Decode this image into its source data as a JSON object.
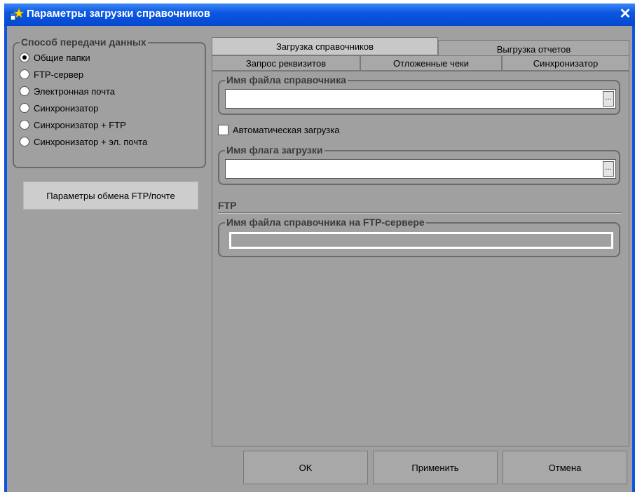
{
  "window": {
    "title": "Параметры загрузки справочников",
    "icon": "app-settings-icon",
    "close_icon": "close-icon"
  },
  "transfer": {
    "legend": "Способ передачи данных",
    "options": [
      {
        "label": "Общие папки",
        "checked": true
      },
      {
        "label": "FTP-сервер",
        "checked": false
      },
      {
        "label": "Электронная почта",
        "checked": false
      },
      {
        "label": "Синхронизатор",
        "checked": false
      },
      {
        "label": "Синхронизатор + FTP",
        "checked": false
      },
      {
        "label": "Синхронизатор + эл. почта",
        "checked": false
      }
    ]
  },
  "ftp_params_button": "Параметры обмена FTP/почте",
  "tabs": {
    "row_top": [
      {
        "label": "Загрузка справочников",
        "active": true
      },
      {
        "label": "Выгрузка отчетов",
        "active": false
      }
    ],
    "row_bottom": [
      {
        "label": "Запрос реквизитов",
        "active": false
      },
      {
        "label": "Отложенные чеки",
        "active": false
      },
      {
        "label": "Синхронизатор",
        "active": false
      }
    ]
  },
  "tab_content": {
    "file_name_group": "Имя файла справочника",
    "file_name_value": "",
    "browse_label": "...",
    "auto_load_label": "Автоматическая загрузка",
    "auto_load_checked": false,
    "flag_group": "Имя флага загрузки",
    "flag_value": "",
    "ftp_section": "FTP",
    "ftp_file_group": "Имя файла справочника на FTP-сервере",
    "ftp_file_value": ""
  },
  "buttons": {
    "ok": "OK",
    "apply": "Применить",
    "cancel": "Отмена"
  },
  "colors": {
    "titlebar": "#0b58e2",
    "dialog_bg": "#a0a0a0"
  }
}
